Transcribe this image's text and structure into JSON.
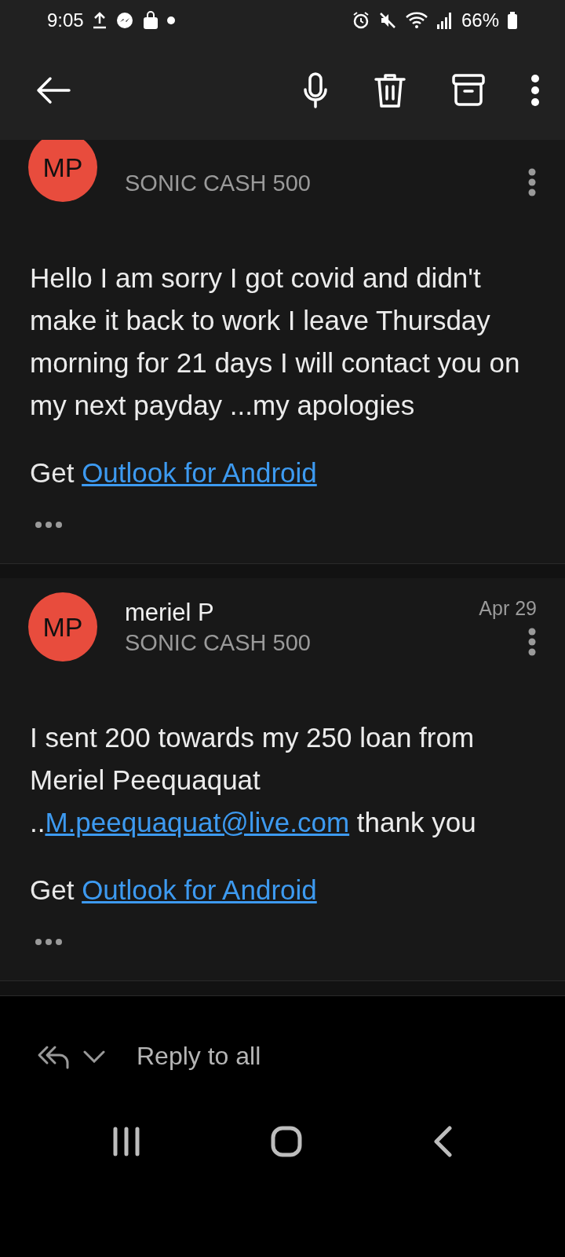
{
  "status_bar": {
    "time": "9:05",
    "battery": "66%"
  },
  "messages": [
    {
      "initials": "MP",
      "subject": "SONIC CASH 500",
      "clipped": true,
      "body": [
        {
          "kind": "text",
          "text": "Hello I am sorry I got covid and didn't make it back to work I leave Thursday morning for 21 days I will contact you on my next payday ...my apologies"
        }
      ],
      "signature_prefix": "Get ",
      "signature_link": "Outlook for Android"
    },
    {
      "initials": "MP",
      "sender": "meriel P",
      "date": "Apr 29",
      "subject": "SONIC CASH 500",
      "clipped": false,
      "body": [
        {
          "kind": "text",
          "text": "I sent 200 towards my 250 loan from Meriel Peequaquat .."
        },
        {
          "kind": "link",
          "text": "M.peequaquat@live.com"
        },
        {
          "kind": "text",
          "text": " thank you"
        }
      ],
      "signature_prefix": "Get ",
      "signature_link": "Outlook for Android"
    }
  ],
  "reply_bar": {
    "label": "Reply to all"
  }
}
